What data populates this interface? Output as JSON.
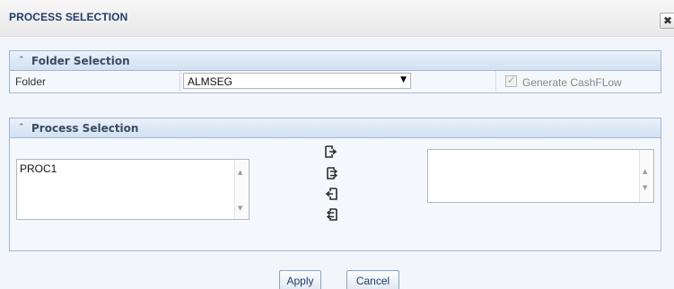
{
  "dialog": {
    "title": "PROCESS SELECTION",
    "close_label": "✖"
  },
  "folder_section": {
    "header": "Folder Selection",
    "collapse_icon": "⌃",
    "folder_label": "Folder",
    "folder_value": "ALMSEG",
    "generate_cashflow_label": "Generate CashFLow",
    "generate_cashflow_checked": true,
    "generate_cashflow_disabled": true
  },
  "process_section": {
    "header": "Process Selection",
    "collapse_icon": "⌃",
    "available_items": [
      "PROC1"
    ],
    "selected_items": [],
    "movers": [
      "move-selected-right-icon",
      "move-all-right-icon",
      "move-selected-left-icon",
      "move-all-left-icon"
    ]
  },
  "footer": {
    "apply_label": "Apply",
    "cancel_label": "Cancel"
  },
  "colors": {
    "title_text": "#1f3d6b",
    "panel_border": "#9fb7d6",
    "panel_header": "#d2e0f1",
    "content_bg": "#f2f6fb",
    "mover_icon": "#2b2b2b"
  }
}
